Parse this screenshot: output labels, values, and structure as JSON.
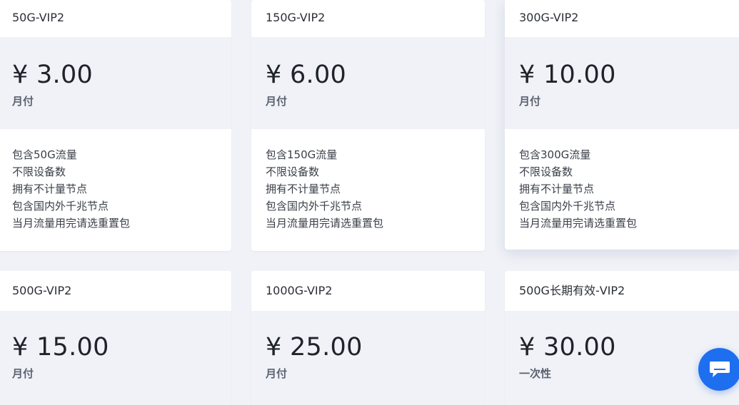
{
  "plans": [
    {
      "name": "50G-VIP2",
      "price": "¥ 3.00",
      "cycle": "月付",
      "features": [
        "包含50G流量",
        "不限设备数",
        "拥有不计量节点",
        "包含国内外千兆节点",
        "当月流量用完请选重置包"
      ]
    },
    {
      "name": "150G-VIP2",
      "price": "¥ 6.00",
      "cycle": "月付",
      "features": [
        "包含150G流量",
        "不限设备数",
        "拥有不计量节点",
        "包含国内外千兆节点",
        "当月流量用完请选重置包"
      ]
    },
    {
      "name": "300G-VIP2",
      "price": "¥ 10.00",
      "cycle": "月付",
      "features": [
        "包含300G流量",
        "不限设备数",
        "拥有不计量节点",
        "包含国内外千兆节点",
        "当月流量用完请选重置包"
      ]
    },
    {
      "name": "500G-VIP2",
      "price": "¥ 15.00",
      "cycle": "月付"
    },
    {
      "name": "1000G-VIP2",
      "price": "¥ 25.00",
      "cycle": "月付"
    },
    {
      "name": "500G长期有效-VIP2",
      "price": "¥ 30.00",
      "cycle": "一次性"
    }
  ],
  "chat_button": {
    "icon": "chat-bubble-icon",
    "color": "#1e6ff0"
  }
}
